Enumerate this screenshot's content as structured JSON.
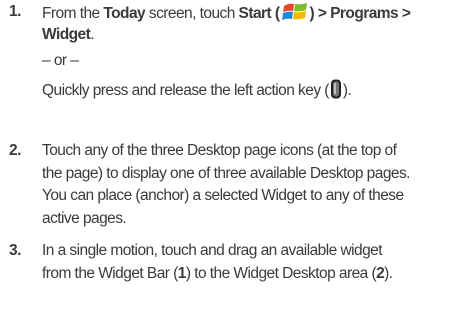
{
  "steps": [
    {
      "number": "1.",
      "line1_prefix": "From the ",
      "line1_today": "Today",
      "line1_mid": " screen, touch ",
      "line1_start": "Start",
      "line1_open_paren": " (",
      "line1_after_icon": ") > Programs >",
      "line2_widget": "Widget",
      "line2_period": ".",
      "or_text": "– or –",
      "alt_prefix": "Quickly press and release the left action key (",
      "alt_suffix": ")."
    },
    {
      "number": "2.",
      "line1": "Touch any of the three Desktop page icons (at the top of",
      "line2": "the page) to display one of three available Desktop pages.",
      "line3": "You can place (anchor) a selected Widget to any of these",
      "line4": "active pages."
    },
    {
      "number": "3.",
      "line1": "In a single motion, touch and drag an available widget",
      "line2_prefix": "from the Widget Bar (",
      "line2_num1": "1",
      "line2_mid": ") to the Widget Desktop area (",
      "line2_num2": "2",
      "line2_suffix": ")."
    }
  ],
  "icons": {
    "start": "windows-start-icon",
    "action_key": "left-action-key-icon"
  },
  "colors": {
    "text": "#3a3a3a",
    "win_red": "#e8452c",
    "win_green": "#7cbb2a",
    "win_blue": "#1e88d8",
    "win_yellow": "#f5b800"
  }
}
